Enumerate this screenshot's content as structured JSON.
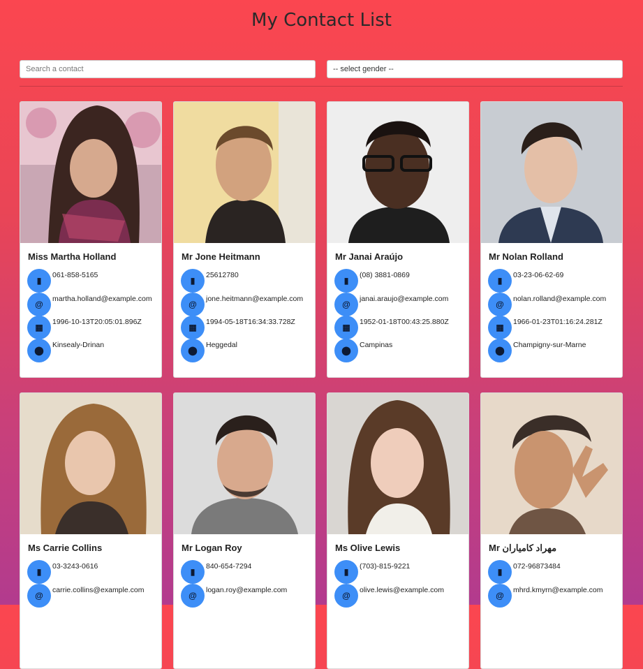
{
  "header": {
    "title": "My Contact List"
  },
  "search": {
    "placeholder": "Search a contact"
  },
  "gender_select": {
    "selected": "-- select gender --"
  },
  "theme": {
    "icon_circle": "#3d8ef7",
    "gradient_top": "#fb4650",
    "gradient_bottom": "#b23b8e"
  },
  "contacts": [
    {
      "name": "Miss Martha Holland",
      "phone": "061-858-5165",
      "email": "martha.holland@example.com",
      "dob": "1996-10-13T20:05:01.896Z",
      "city": "Kinsealy-Drinan"
    },
    {
      "name": "Mr Jone Heitmann",
      "phone": "25612780",
      "email": "jone.heitmann@example.com",
      "dob": "1994-05-18T16:34:33.728Z",
      "city": "Heggedal"
    },
    {
      "name": "Mr Janai Araújo",
      "phone": "(08) 3881-0869",
      "email": "janai.araujo@example.com",
      "dob": "1952-01-18T00:43:25.880Z",
      "city": "Campinas"
    },
    {
      "name": "Mr Nolan Rolland",
      "phone": "03-23-06-62-69",
      "email": "nolan.rolland@example.com",
      "dob": "1966-01-23T01:16:24.281Z",
      "city": "Champigny-sur-Marne"
    },
    {
      "name": "Ms Carrie Collins",
      "phone": "03-3243-0616",
      "email": "carrie.collins@example.com",
      "dob": "",
      "city": ""
    },
    {
      "name": "Mr Logan Roy",
      "phone": "840-654-7294",
      "email": "logan.roy@example.com",
      "dob": "",
      "city": ""
    },
    {
      "name": "Ms Olive Lewis",
      "phone": "(703)-815-9221",
      "email": "olive.lewis@example.com",
      "dob": "",
      "city": ""
    },
    {
      "name": "Mr مهراد کامیاران",
      "phone": "072-96873484",
      "email": "mhrd.kmyrn@example.com",
      "dob": "",
      "city": ""
    }
  ],
  "icons": {
    "phone": "phone-icon",
    "email": "at-icon",
    "dob": "calendar-icon",
    "city": "location-pin-icon"
  }
}
